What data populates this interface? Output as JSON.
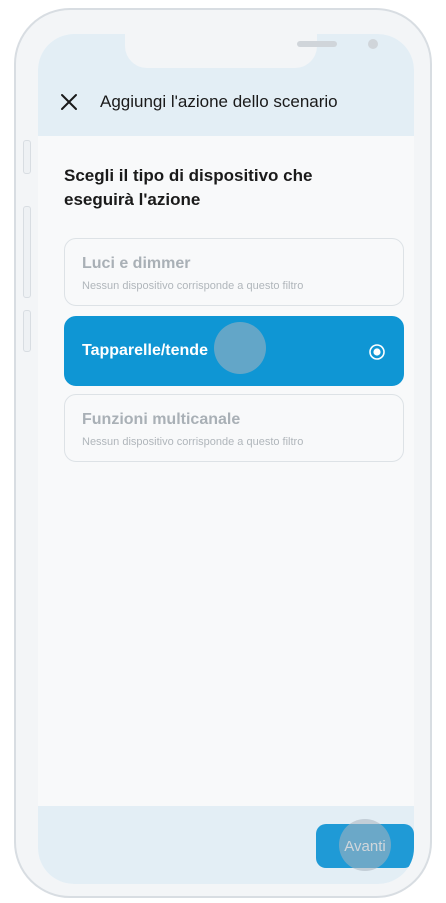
{
  "header": {
    "title": "Aggiungi l'azione dello scenario",
    "close_icon": "close-icon"
  },
  "main": {
    "question": "Scegli il tipo di dispositivo che eseguirà l'azione",
    "options": [
      {
        "title": "Luci e dimmer",
        "subtitle": "Nessun dispositivo corrisponde a questo filtro",
        "selected": false,
        "enabled": false
      },
      {
        "title": "Tapparelle/tende",
        "subtitle": "",
        "selected": true,
        "enabled": true
      },
      {
        "title": "Funzioni multicanale",
        "subtitle": "Nessun dispositivo corrisponde a questo filtro",
        "selected": false,
        "enabled": false
      }
    ]
  },
  "footer": {
    "next_label": "Avanti"
  },
  "colors": {
    "accent": "#0f96d4",
    "header_bg": "#e3eef5",
    "disabled_text": "#a9b0b6"
  }
}
